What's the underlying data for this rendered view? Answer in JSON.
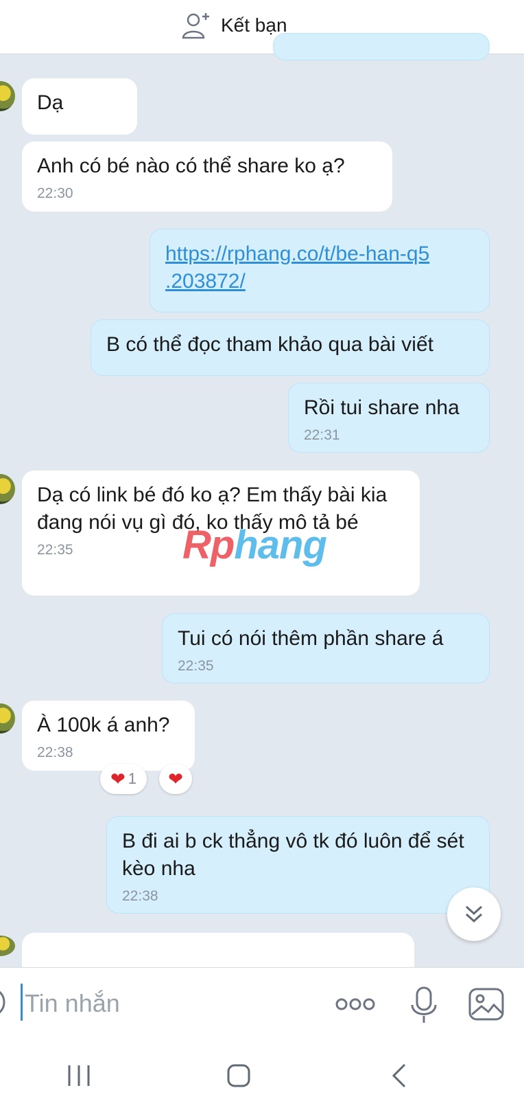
{
  "header": {
    "add_friend_label": "Kết bạn",
    "add_friend_icon": "add-user-icon"
  },
  "messages": [
    {
      "side": "in",
      "text": "Dạ",
      "time": ""
    },
    {
      "side": "in",
      "text": "Anh có bé nào có thể share ko ạ?",
      "time": "22:30"
    },
    {
      "side": "out",
      "text": "https://rphang.co/t/be-han-q5.203872/",
      "is_link": true,
      "time": ""
    },
    {
      "side": "out",
      "text": "B có thể đọc tham khảo qua bài viết",
      "time": ""
    },
    {
      "side": "out",
      "text": "Rồi tui share nha",
      "time": "22:31"
    },
    {
      "side": "in",
      "text": "Dạ có link bé đó ko ạ? Em thấy bài kia đang nói vụ gì đó, ko thấy mô tả bé",
      "time": "22:35"
    },
    {
      "side": "out",
      "text": "Tui có nói thêm phần share á",
      "time": "22:35"
    },
    {
      "side": "in",
      "text": "À 100k á anh?",
      "time": "22:38"
    },
    {
      "side": "out",
      "text": "B đi ai b ck thẳng vô tk đó luôn để sét kèo nha",
      "time": "22:38"
    }
  ],
  "link_lines": [
    "https://rphang.co/t/be-han-q5",
    ".203872/"
  ],
  "reactions": {
    "count_label": "1",
    "heart_glyph": "❤",
    "heart_color": "#e0242b"
  },
  "watermark": {
    "part1": "Rp",
    "part2": "hang"
  },
  "composer": {
    "placeholder": "Tin nhắn"
  },
  "colors": {
    "incoming_bubble": "#ffffff",
    "outgoing_bubble": "#d6effd",
    "background": "#e2e8ef",
    "accent": "#2f8fd6"
  }
}
